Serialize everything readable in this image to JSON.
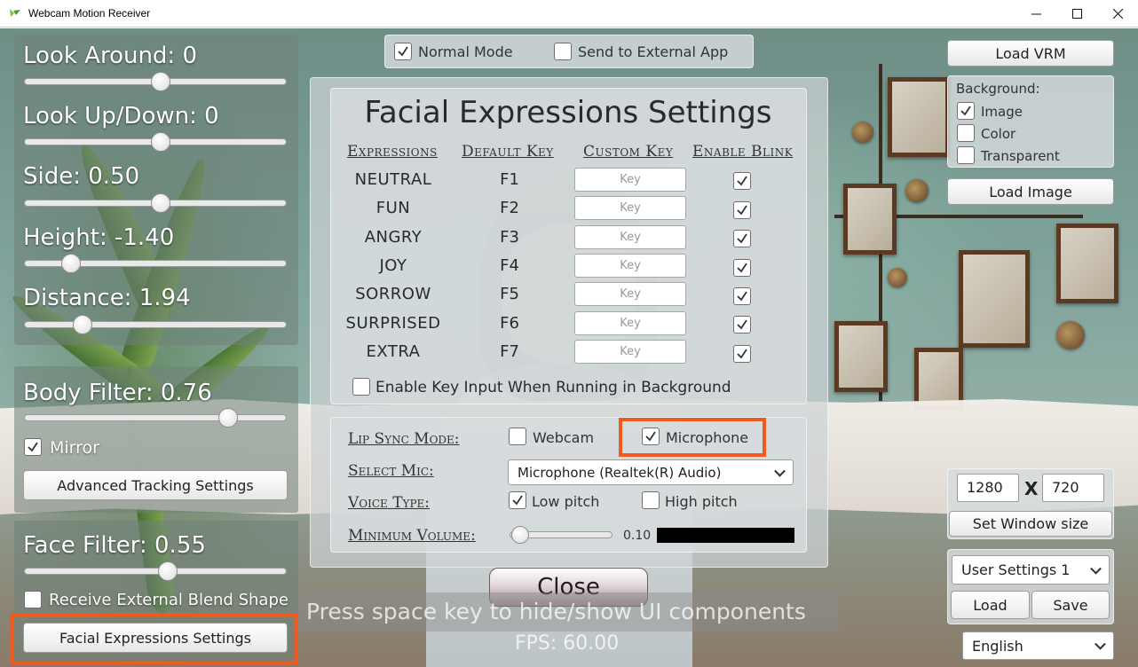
{
  "window": {
    "title": "Webcam Motion Receiver",
    "minimize_icon": "minimize-icon",
    "maximize_icon": "maximize-icon",
    "close_icon": "close-icon"
  },
  "colors": {
    "highlight": "#ef5a1f",
    "panel_light": "#d7dcde",
    "accent_icon": "#7ac043"
  },
  "left_panel": {
    "sliders": [
      {
        "label": "Look Around: 0",
        "value": 0.5
      },
      {
        "label": "Look Up/Down: 0",
        "value": 0.5
      },
      {
        "label": "Side: 0.50",
        "value": 0.5
      },
      {
        "label": "Height: -1.40",
        "value": 0.18
      },
      {
        "label": "Distance: 1.94",
        "value": 0.22
      }
    ],
    "body_filter": {
      "label": "Body Filter: 0.76",
      "value": 0.78
    },
    "mirror": {
      "label": "Mirror",
      "checked": true
    },
    "advanced_tracking_label": "Advanced Tracking Settings",
    "face_filter": {
      "label": "Face Filter: 0.55",
      "value": 0.55
    },
    "receive_blend_shape": {
      "label": "Receive External Blend Shape",
      "checked": false
    },
    "facial_expressions_button": "Facial Expressions Settings"
  },
  "top_bar": {
    "normal_mode": {
      "label": "Normal Mode",
      "checked": true
    },
    "send_external": {
      "label": "Send to External App",
      "checked": false
    }
  },
  "facial_dialog": {
    "title": "Facial Expressions Settings",
    "headers": [
      "Expressions",
      "Default Key",
      "Custom Key",
      "Enable Blink"
    ],
    "rows": [
      {
        "name": "NEUTRAL",
        "key": "F1",
        "placeholder": "Key",
        "blink": true
      },
      {
        "name": "FUN",
        "key": "F2",
        "placeholder": "Key",
        "blink": true
      },
      {
        "name": "ANGRY",
        "key": "F3",
        "placeholder": "Key",
        "blink": true
      },
      {
        "name": "JOY",
        "key": "F4",
        "placeholder": "Key",
        "blink": true
      },
      {
        "name": "SORROW",
        "key": "F5",
        "placeholder": "Key",
        "blink": true
      },
      {
        "name": "SURPRISED",
        "key": "F6",
        "placeholder": "Key",
        "blink": true
      },
      {
        "name": "EXTRA",
        "key": "F7",
        "placeholder": "Key",
        "blink": true
      }
    ],
    "background_input": {
      "label": "Enable Key Input When Running in Background",
      "checked": false
    },
    "lip_sync": {
      "mode_label": "Lip Sync Mode:",
      "webcam": {
        "label": "Webcam",
        "checked": false
      },
      "microphone": {
        "label": "Microphone",
        "checked": true
      },
      "select_mic_label": "Select Mic:",
      "mic_value": "Microphone (Realtek(R) Audio)",
      "voice_type_label": "Voice Type:",
      "low_pitch": {
        "label": "Low pitch",
        "checked": true
      },
      "high_pitch": {
        "label": "High pitch",
        "checked": false
      },
      "min_volume_label": "Minimum Volume:",
      "min_volume_value": "0.10",
      "min_volume_level": 0.03
    },
    "close_label": "Close"
  },
  "right_panel": {
    "load_vrm": "Load VRM",
    "background_label": "Background:",
    "bg_image": {
      "label": "Image",
      "checked": true
    },
    "bg_color": {
      "label": "Color",
      "checked": false
    },
    "bg_transparent": {
      "label": "Transparent",
      "checked": false
    },
    "load_image": "Load Image",
    "width": "1280",
    "x_label": "X",
    "height": "720",
    "set_window_size": "Set Window size",
    "user_settings": "User Settings 1",
    "load": "Load",
    "save": "Save",
    "language": "English"
  },
  "overlay": {
    "hint": "Press space key to hide/show UI components",
    "fps": "FPS: 60.00"
  }
}
